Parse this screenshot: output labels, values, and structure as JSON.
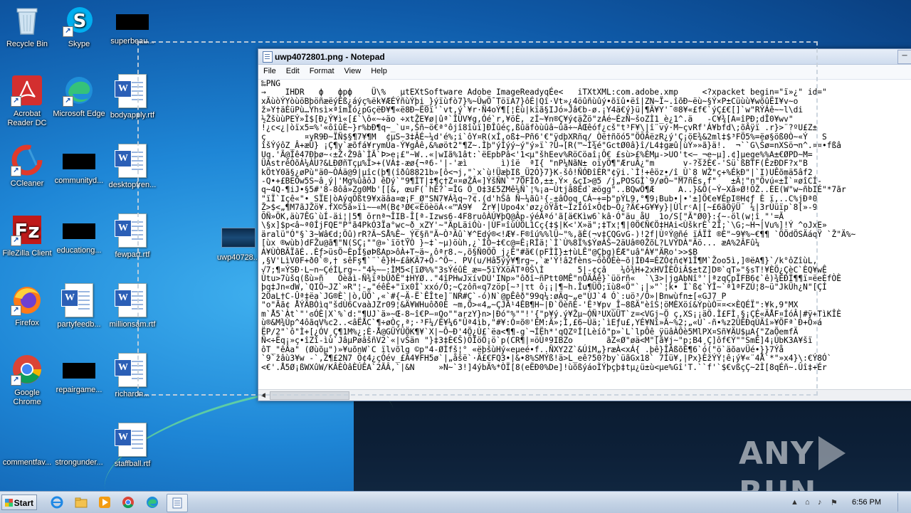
{
  "desktop": {
    "icons": [
      {
        "label": "Recycle Bin",
        "icon": "recycle-bin-icon"
      },
      {
        "label": "Skype",
        "icon": "skype-icon"
      },
      {
        "label": "superbeau...",
        "icon": "redacted-icon"
      },
      {
        "label": "Acrobat Reader DC",
        "icon": "acrobat-icon"
      },
      {
        "label": "Microsoft Edge",
        "icon": "edge-icon"
      },
      {
        "label": "bodyapply.rtf",
        "icon": "word-doc-icon"
      },
      {
        "label": "CCleaner",
        "icon": "ccleaner-icon"
      },
      {
        "label": "communityd...",
        "icon": "redacted-icon"
      },
      {
        "label": "desktopfren...",
        "icon": "word-doc-icon"
      },
      {
        "label": "FileZilla Client",
        "icon": "filezilla-icon"
      },
      {
        "label": "educationg...",
        "icon": "redacted-icon"
      },
      {
        "label": "fewpart.rtf",
        "icon": "word-doc-icon"
      },
      {
        "label": "uwp40728...",
        "icon": "image-thumbnail-icon"
      },
      {
        "label": "Firefox",
        "icon": "firefox-icon"
      },
      {
        "label": "partyfeedb...",
        "icon": "word-doc-icon"
      },
      {
        "label": "millionsam.rtf",
        "icon": "word-doc-icon"
      },
      {
        "label": "Google Chrome",
        "icon": "chrome-icon"
      },
      {
        "label": "repairgame...",
        "icon": "redacted-icon"
      },
      {
        "label": "richardn...",
        "icon": "word-doc-icon"
      },
      {
        "label": "commentfav...",
        "icon": "blank-icon"
      },
      {
        "label": "strongunder...",
        "icon": "blank-icon"
      },
      {
        "label": "staffball.rtf",
        "icon": "word-doc-icon"
      }
    ]
  },
  "notepad": {
    "title": "uwp4072801.png - Notepad",
    "menu": [
      "File",
      "Edit",
      "Format",
      "View",
      "Help"
    ],
    "content": "‰PNG\n→    IHDR   ϕ   фрф    Ü\\%   µtEXtSoftware Adobe ImageReadyqÉe<   iTXtXML:com.adobe.xmp     <?xpacket begin=\"ï»¿\" id=\"\nxÃùòÝYòùöBþöñæëýÊß¿áýç%ëk¥ÆÉÝñùÝþi_}ýïùfò7}%~ÛwÖ¯TöïA7}ôÉ|Qî·Vt»¿4öûñùûý•õïû•ëî|ZN~Ï~.îõÐ~ëù~§Ý×P±Cüùù¥wõûËI¥v~o\nž»Y†äÈüPù…Yhsì×ªîmÍó¿pGçëÐ¥¶«ë8Ð~Ë0ï'`vt,ý`¥r·Ñ4oÝ¶[¦Èù|kïã§IJó»Jâ€b-ø.¡Y4ä€ý}ü|¶Ä¥Y'¯®8¥«£f€`ýÇ£€[]`w\"RÝÁê~~l\\di\n½ŽšùùPEÝ»Ì$[Ð¿Ý¥ì«[£`\\ô«~÷äo ÷xtŽE¥ø|ûª`ÎÚV¥g,Óé`r,¥öÈ, zÍ~¥n®Ç¥ý¢äŽö\"zÁé~ÉzÑ~šoZÌ1_è¿1^.ä   -C¥¾[A=îPÐ;dÎ0¥wv\"\n!¿c<¿|òïx5=%'«ôîûÈ~}r%bÐ¶q~_`u¤,Šñ~ö€ª°ôjî8îùï]ÐÎûéç,ßûäfòùûâ~ûã÷~ÂŒêóf¿cš\"t³F¥\\|î¨vý·M~çvRf'Á¥bfd\\;õÂÿï .r}>¨?ºU£Z±\nç        ¤yR9Ð~ÏÑ$§¶7¥¶M  ¢µS~3‡ÂÉ~¼d'é%;i`ôY¤R(xÍ,oß‡~Pñ6'€\"ÿdþXRñq/_Òë†ñõó5\"ÖÕÄëzR¿ý'Ç¡öE¾&2ml‡$³FÖ5%=ëø§öß0Ò~«Ý   S\nîšÝýôZ_Â+æÛ} ¡Ç¶y`æõfá¥rymÙa-Ý¥gÂê,&%øöt2\"¶Z~.Ìþ\"ýÍýý~ý\"ý»ï`?Û→[R(™~Ì¾é\"GctØ0â}î/L4‡gæû|ùÝ»»ã}ä!.  ¬``G\\Šø=nXSö¬n^.¤¤•fßâ\nUq.'Ã@Íê47Ðþø~‹±Ž‹Ž9â`ÌÃ`Þ>e¡£\"~W..«|wIã%1ât:`ëEpbPâ<'1<µ\"šhEev%RöCöaî¡Ô€ £sù>£%ÈMµ->UO't<—_¬e~µ].¢]µege%%A±€ØPD~M=\nÜÀstrêÒõÀ¼ÀU?&LÐØñTçµ%Î>+(VÀ‡-æø{¬ª6-'|-'æì       ì)îë  ªI{ \"nP¼NãN± oïyÖ¶\"ÆruÂ¿\"m      v-?šžÈ€-'Sü`ßBTF(ÊzÐDF?x\"B\nkÖtY0ã§¿øPù\"ä0~ÒÁä@9|µîc(þ¶(îðû8821b»[ô<¬j,\"`x`ù!ÜæþIß_Ü2Ó}7}K-šô!ÑÓÐîÈR\"¢ÿi.`Ì!+êöz•/î_Ù`8 WŽ\"ç+%ÉkÐ\"|`I)UÊõmä5âf2\n-Q•+£BEÓw5S~â¸ý|'Mg%ûâôJ êDý`\"9¶ÌT|‡¶ç†Z¤¤øŽÂ«]ÝšÑN`\"7ÖFÌð,±±.Ý×¸&çI>@5 /j„POSGÌ`9/øÕ~\"M7ñÉs,f\"   ±Ä¦\"n\"Övú«±Î`¤øîCÍ-\nq~4Q-¶iJ•§5#'8-8ôâ»Zg0Mb'[[&, œuF(`hÊ?`=ÎG Ö_O‡3£5ZMê¼Ñ`¦%¡a~Ùtjã8Ed`æögg\"..BQwÖ¶Æ     A..}&Ö(~Ý~Xâ»Ø!ÕŽ..ÈE(W\"w~ñbIÉ\"*7ãr\n\"ïÏ`Içê«\"• SÏE|òAýqÕßt9¥xäâa¤œ¡F_Ø\"SN7¥Á¾q~?¢.(d'hŠâ Ñ~¼ãû¹{-±âÒoq¸CÁ~+=þ\"pÝL9,°¶9¡Bub•|•'±]Ö€e¥ÉpI®H¢ƒ È ï,..C%jÐª0\nŽ>$<„¶M7ãJŽö¥.fX©5â»ïì~—«M(B¢³Ø€«ÉöèöÁ‹«™A9¥  Žr¥|Upo4x'øz¿öŸåt~ÏzÏóî×Ô¢b~Ó¿?Ä€+G¥¥y}|ÙlrᶜA|[~£6ãÓÿÜ¯ ¼|3rÙüïp`8[»-9\nÕÑ»ÖK,äù7ÊG`ùÍ-äi¦|5¶ ŏrnª¬ÎIB-Î[ª-Izws6-4F8ruôÀÚ¥þQ@Âp-ýéÀªó'ã[ä€Kìw6`kâ·Ó\"äu åU  1o/S[\"Ã\"Ø0}:{~-öl(w¦î¸\"'=Ã\n\\§x]$p<â~ª0ÍjFQE\"P\"ã4PkÓ3Ïa°wc~ð_xZY'~\"ÄpLäiÓù·|ÙF¤îùÙÖL1Cç{‡$|K<'X»ä\";‡Tx¦¶|0Ö€Ñ€Ö‡HAi<ÙškrÈ`2Ï;`\\G;~H¬|Vu%]!Ý ^oJxE»\näralü\"Ó\"§`3~Wâ€d;Öû)rR?Ä~SÅ%Ê~_Ý€§ñ\"Ã~Ò³Âû`¥^Edý®<!Æ¥-F®îú%%lÜ~\"%,ãÈ(¬v‡CQGvG-)!2f|ÙºÝ@ñé ïÁÏÌ ®È\"~9¥%~€¶¶ `ÖÖdÖSÄáqŸ `Ž\"Ä%~\n[ùx ®wùb)dFŽu@ã¶\"N(SÇ¡\"\"@»`ïötÝÒ }~‡`~µ)öùh,¿`ÍÒ~‡€c@=Ê¡RÍä¦`Ì`Ù%8Ï%$ÝøÀŠ~2äUâ®0ŽõL?LVÝDÀ\"Äö... æA%2ÂFû¼\nÁ¥ÙÒBÃÏãÉ..Èƒ>üsÖ~ÈpÍ§øÞßAp>ôÀ+T~ä~,ôªr8.~,õ§Ñ0ÖÕ_j¿Ê\"#ã€(pFÌÌ}±†ùLÊ\"@Çþg)ÉÆ\"uâ\"Á¥\"ÄRo'>>$B\n,§V'LìV0F+ð0`®,† sêFş¶`¨`ê}H~£âKÄ7+Ö-^Ö~. PV(u/Hâ5ýý¥¶rg~,`æ'Ý!â2fèns~öôÖÉè~õ|ÌÐ4=ÉZÓ¢ñ¢¥1Î¶M`Žoo5ì,]®ëA¶}`/k°ôZîùL,\n√7;¶¤ÝSÐ·L~n~ÇéÌLrg~-\"4½~—:ÌM5<[ïØ%%\"3sÝéûÈ_æ=~5ïÝXöÄTª0Š\\Ì       5|-¢çâ   ¼ô¾H+2xHVÎÈÕiÂ$±tZ]D®`qT»\"§sT!¥ÈÖ¿ÇèC`ÈQ¥wÊ\nÙtu>7ùšq(ßù»ñ   Ôèáì-Ñ¾ïªbÜðÊ\"‡HYØ..\"4îPHwJxívDÙ'INp»\"ôðî~ñPtt0MÊ\"nÔÄÂê}`üörñ«  `\\3>|jgAbNî°'|ªzqÇpĬFB6¢`ê)¾ÈÐÏ¶¶ï¤ëeÈfÒÈ\nþq‡Jn«dW,`QIÖ~JZ`»R\"¦-„\"éêÈ+\"ïx0Ì`xxó/Ö;~Çzôñ«q7zöp[~³|τt ô¡¡|¶~h.Îu¶ÜÖ;ïù8«Ö\"`¡|»\"`¦k• Ì`ß¢`ÝÎ~`ª1ªFZÚ¦8~ü\"JkÜh¿N\"[ÇÍ\n2ÖaL†C-Ûª‡ëa`JG®È`|ò,ÜÖ`,«`#{~Ä-Ë`ÊÎte]¨NR#Ç`-ó)N`@pÊêð\"99q¼:øÄq~„e\"ÙJ`4 Ó`:uö³/Ô»|Bnwùfn±[«GJ7_P\n\"o\"Ãã¢ ÅÝÄBÒìq\"šdÙ6CvaàJZr09¦&Ä¥WHuôð0È ~m,Ö>«4„~ÇJÂ¹4ÊB¶H~|Ð`ÖèñÉ-'Ê³¥pv_Î~8ßÄ\"èîS¦öMÈXöí&ÝpùÒ¤¤<×ÈQÉÏ\":¥k,9\"MX\nm`Å5`Àt`\"'ϭÓÈ|X`%`d:\"¶UJ`ä»~Œ-8~î€P—¤Qo\"\"arzY}n>|Ðó\"%\"\"!'{\"p¥ý.ý¥Žµ~ÓÑ³UXùÜT`z=<VGj~Ö ç,XS¡¡äÖ.Ì£FÌ.§¡ÇÉ«ÄÅF¤ÍóÂ|#ÿ+TìKÎÈ\nù®&M¾Ùp^4ôãqV%c2..<âËÅC`¶÷øÒç,ª;·³F¼/Ë¥¼6\"Ûª4ìb,\"#¥:Ó¤õ®'ÉM:Ä»;Ì,£6~Ûä;`ìEƒu£,YÉ¥Nî»Ã~%2;„«Ú`-ñ•%z2ÛÊÐqÙÄî»¥ÖFª`Ð+Ò»á\nËP/2\"`ô\"Ì+[¿ÓV¸Ç¶1M%¿;È·Å@GÜÝÛÖK¶¥`X|~Ô~Ð'4Ö¿Ù£`ëa<¶¶-g`¬ÍËh*'qQZºÍ[Lèíô\"p»`L`lpÔê_ÿüâÀÔè5MlPX¤Sñ¥ÄU$µA{\"ZaÖemfÄ\nÑ<÷Ëq¡»ç•îZî-ìù`JâµPøâšñV2`«|vŠän \"}‡3‡È€Š)ÕÎöÖ¡ö`p(CR¶|¤öÙª9IBZo       ãZ«Ø\"øä<M\"[ã¥j~\"p;B4¸Ç]ôf€Ý\"\"SmÈ]4¡ÚbK3A¥šï\nôT_\"êÂa\" (Øùõµ\")»¥uõnW`C ïlvõlg ©p\"4-ØÌfš¦° «ëþšùHý«eµeé•f..ÑXY2Z`&ÚîM„}ræÀ<xÁ{ .þê}ÎÂßõÊ¶6`ó(\"ö`äõavÜé•}}7Ýå\n`9`žâù3¥w -`,Ž¶£2N7 Õ¢4¿çÓév_£A4¥FH5ø`|„åšë`·Ä£€FQ3•|&•8%SMÝß!ä>L_eê?50?by`üãGx18` 7Íü¥,|Px}ÈžÝÝ¦ê¡ý¥«¨4Å`*\"»x4}\\:€Ý8Ó`\n<€'.Å5Ø¡ßWXûW/KÂÈÒâÈÚÊA`2ÃÂ,`|&N     »N~`3!]4ýbÄ%*ÒÏ[8(eËÐ0%De]!ùõßýáoÌÝþçþ‡tµ¿ü±ù<µe%Gî'T.``f'`$€vßçÇ~2Ì[8qÉñ~.Ûî‡+Ér"
  },
  "taskbar": {
    "start_label": "Start",
    "clock": "6:56 PM",
    "apps": [
      "ie-icon",
      "explorer-icon",
      "media-player-icon",
      "chrome-icon",
      "edge-icon",
      "notepad-icon"
    ]
  },
  "watermark": {
    "text_left": "ANY",
    "text_right": "RUN"
  },
  "colors": {
    "desktop": "#1e86d6",
    "taskbar": "#c5d4e6",
    "titlebar": "#cfdcee"
  }
}
